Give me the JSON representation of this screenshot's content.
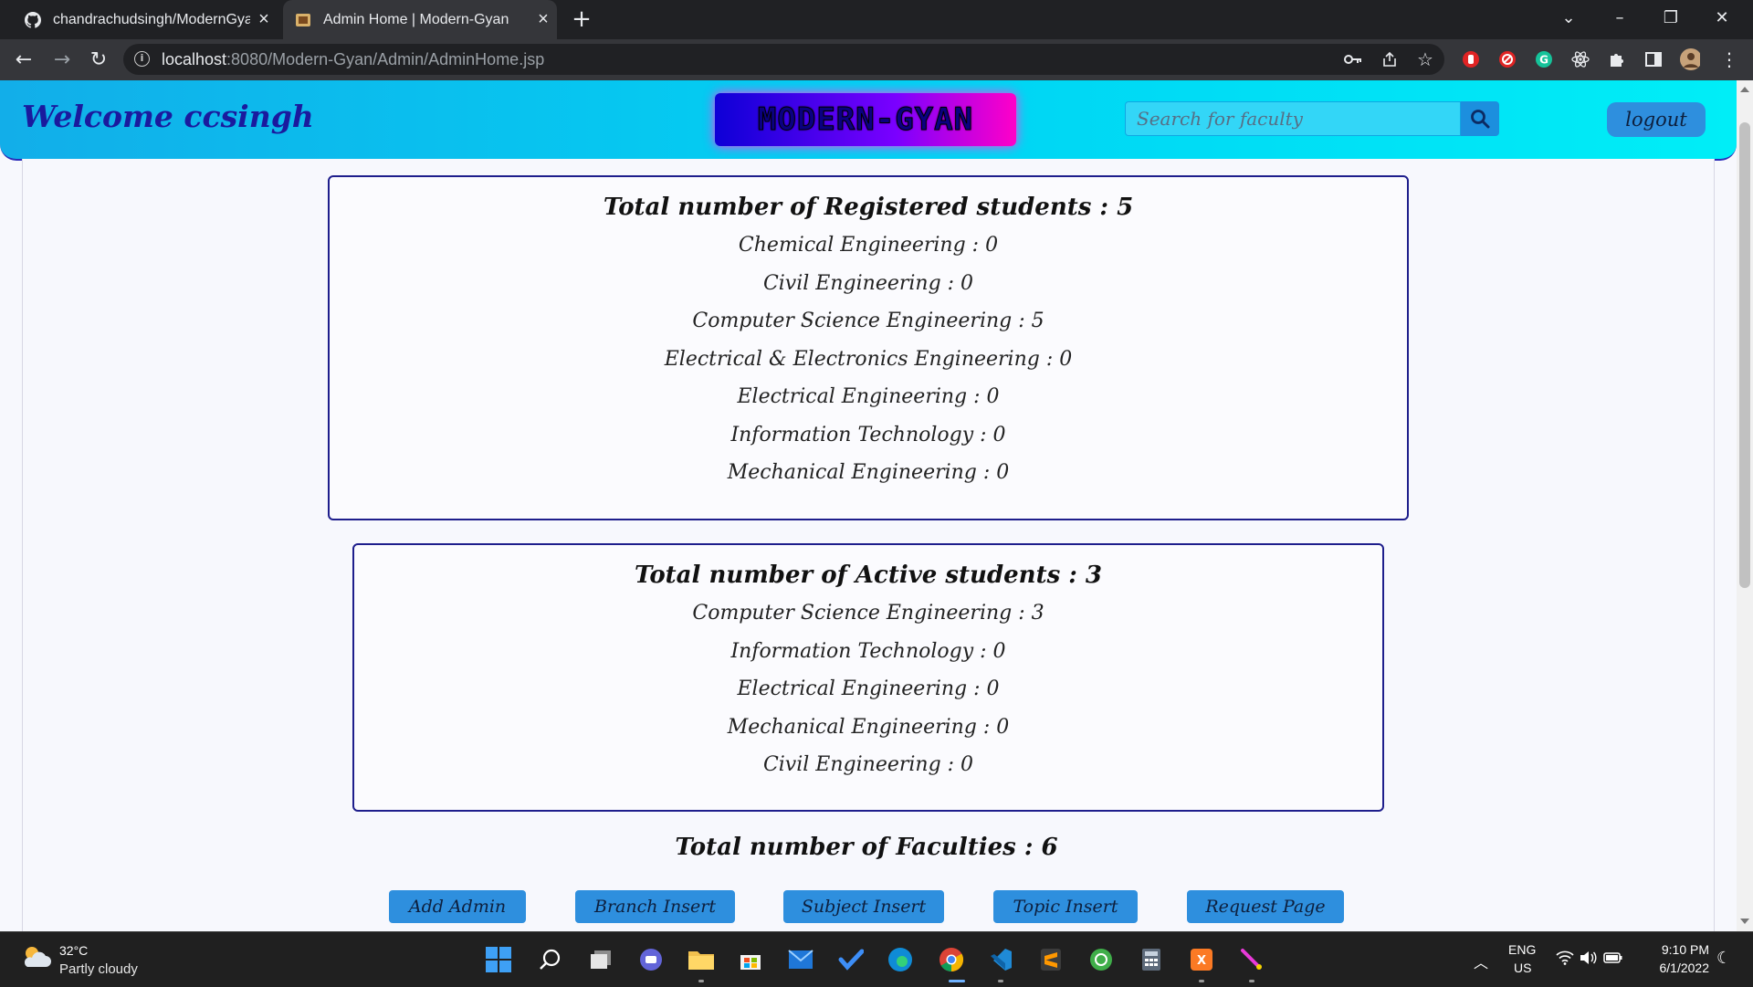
{
  "browser": {
    "tabs": [
      {
        "title": "chandrachudsingh/ModernGyan",
        "active": false
      },
      {
        "title": "Admin Home | Modern-Gyan",
        "active": true
      }
    ],
    "url_host": "localhost",
    "url_path": ":8080/Modern-Gyan/Admin/AdminHome.jsp"
  },
  "header": {
    "welcome": "Welcome ccsingh",
    "logo_text": "MODERN-GYAN",
    "search_placeholder": "Search for faculty",
    "logout_label": "logout"
  },
  "registered": {
    "heading": "Total number of Registered students : 5",
    "rows": [
      "Chemical Engineering : 0",
      "Civil Engineering : 0",
      "Computer Science Engineering : 5",
      "Electrical & Electronics Engineering : 0",
      "Electrical Engineering : 0",
      "Information Technology : 0",
      "Mechanical Engineering : 0"
    ]
  },
  "active": {
    "heading": "Total number of Active students : 3",
    "rows": [
      "Computer Science Engineering : 3",
      "Information Technology : 0",
      "Electrical Engineering : 0",
      "Mechanical Engineering : 0",
      "Civil Engineering : 0"
    ]
  },
  "faculties_heading": "Total number of Faculties : 6",
  "actions": [
    "Add Admin",
    "Branch Insert",
    "Subject Insert",
    "Topic Insert",
    "Request Page"
  ],
  "taskbar": {
    "weather_temp": "32°C",
    "weather_desc": "Partly cloudy",
    "lang_top": "ENG",
    "lang_bottom": "US",
    "time": "9:10 PM",
    "date": "6/1/2022"
  },
  "colors": {
    "header_gradient_start": "#12aee9",
    "header_gradient_end": "#00eef7",
    "button_blue": "#2e8fde",
    "card_border": "#1e1e8c"
  }
}
